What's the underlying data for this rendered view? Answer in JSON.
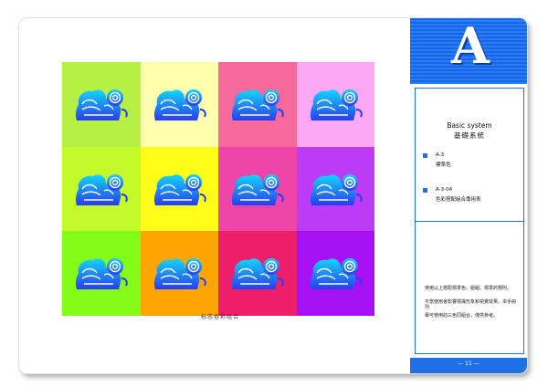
{
  "caption": "标志色彩组合",
  "panel": {
    "letter": "A",
    "title_en": "Basic system",
    "title_zh": "基礎系統",
    "items": [
      {
        "code": "A-3",
        "label": "標準色"
      },
      {
        "code": "A-3-04",
        "label": "色彩搭配組合專用表"
      }
    ],
    "desc_lines": [
      "使用以上搭配標準色、組組、標準的規則。",
      "不當使用會影響標識形象和視覺效果。本手冊列",
      "舉可使用的三色同組合，僅供參考。"
    ],
    "page_number": "— 11 —"
  },
  "tiles": [
    {
      "bg": "#b7f044",
      "fill": "#2a7cf4"
    },
    {
      "bg": "#ffffb0",
      "fill": "#2a7cf4"
    },
    {
      "bg": "#f56a9a",
      "fill": "#2a7cf4"
    },
    {
      "bg": "#fca8f4",
      "fill": "#2a7cf4"
    },
    {
      "bg": "#c4fa2a",
      "fill": "#2a7cf4"
    },
    {
      "bg": "#ffff1a",
      "fill": "#2a7cf4"
    },
    {
      "bg": "#ef45a8",
      "fill": "#2a7cf4"
    },
    {
      "bg": "#bc3cf5",
      "fill": "#2a7cf4"
    },
    {
      "bg": "#84fa18",
      "fill": "#2a7cf4"
    },
    {
      "bg": "#ffa500",
      "fill": "#2a7cf4"
    },
    {
      "bg": "#ee1f6a",
      "fill": "#2a7cf4"
    },
    {
      "bg": "#a511f2",
      "fill": "#2a7cf4"
    }
  ],
  "colors": {
    "accent": "#1f6fe6",
    "logo_top": "#12d6ff",
    "logo_bottom": "#2a3cf0"
  }
}
